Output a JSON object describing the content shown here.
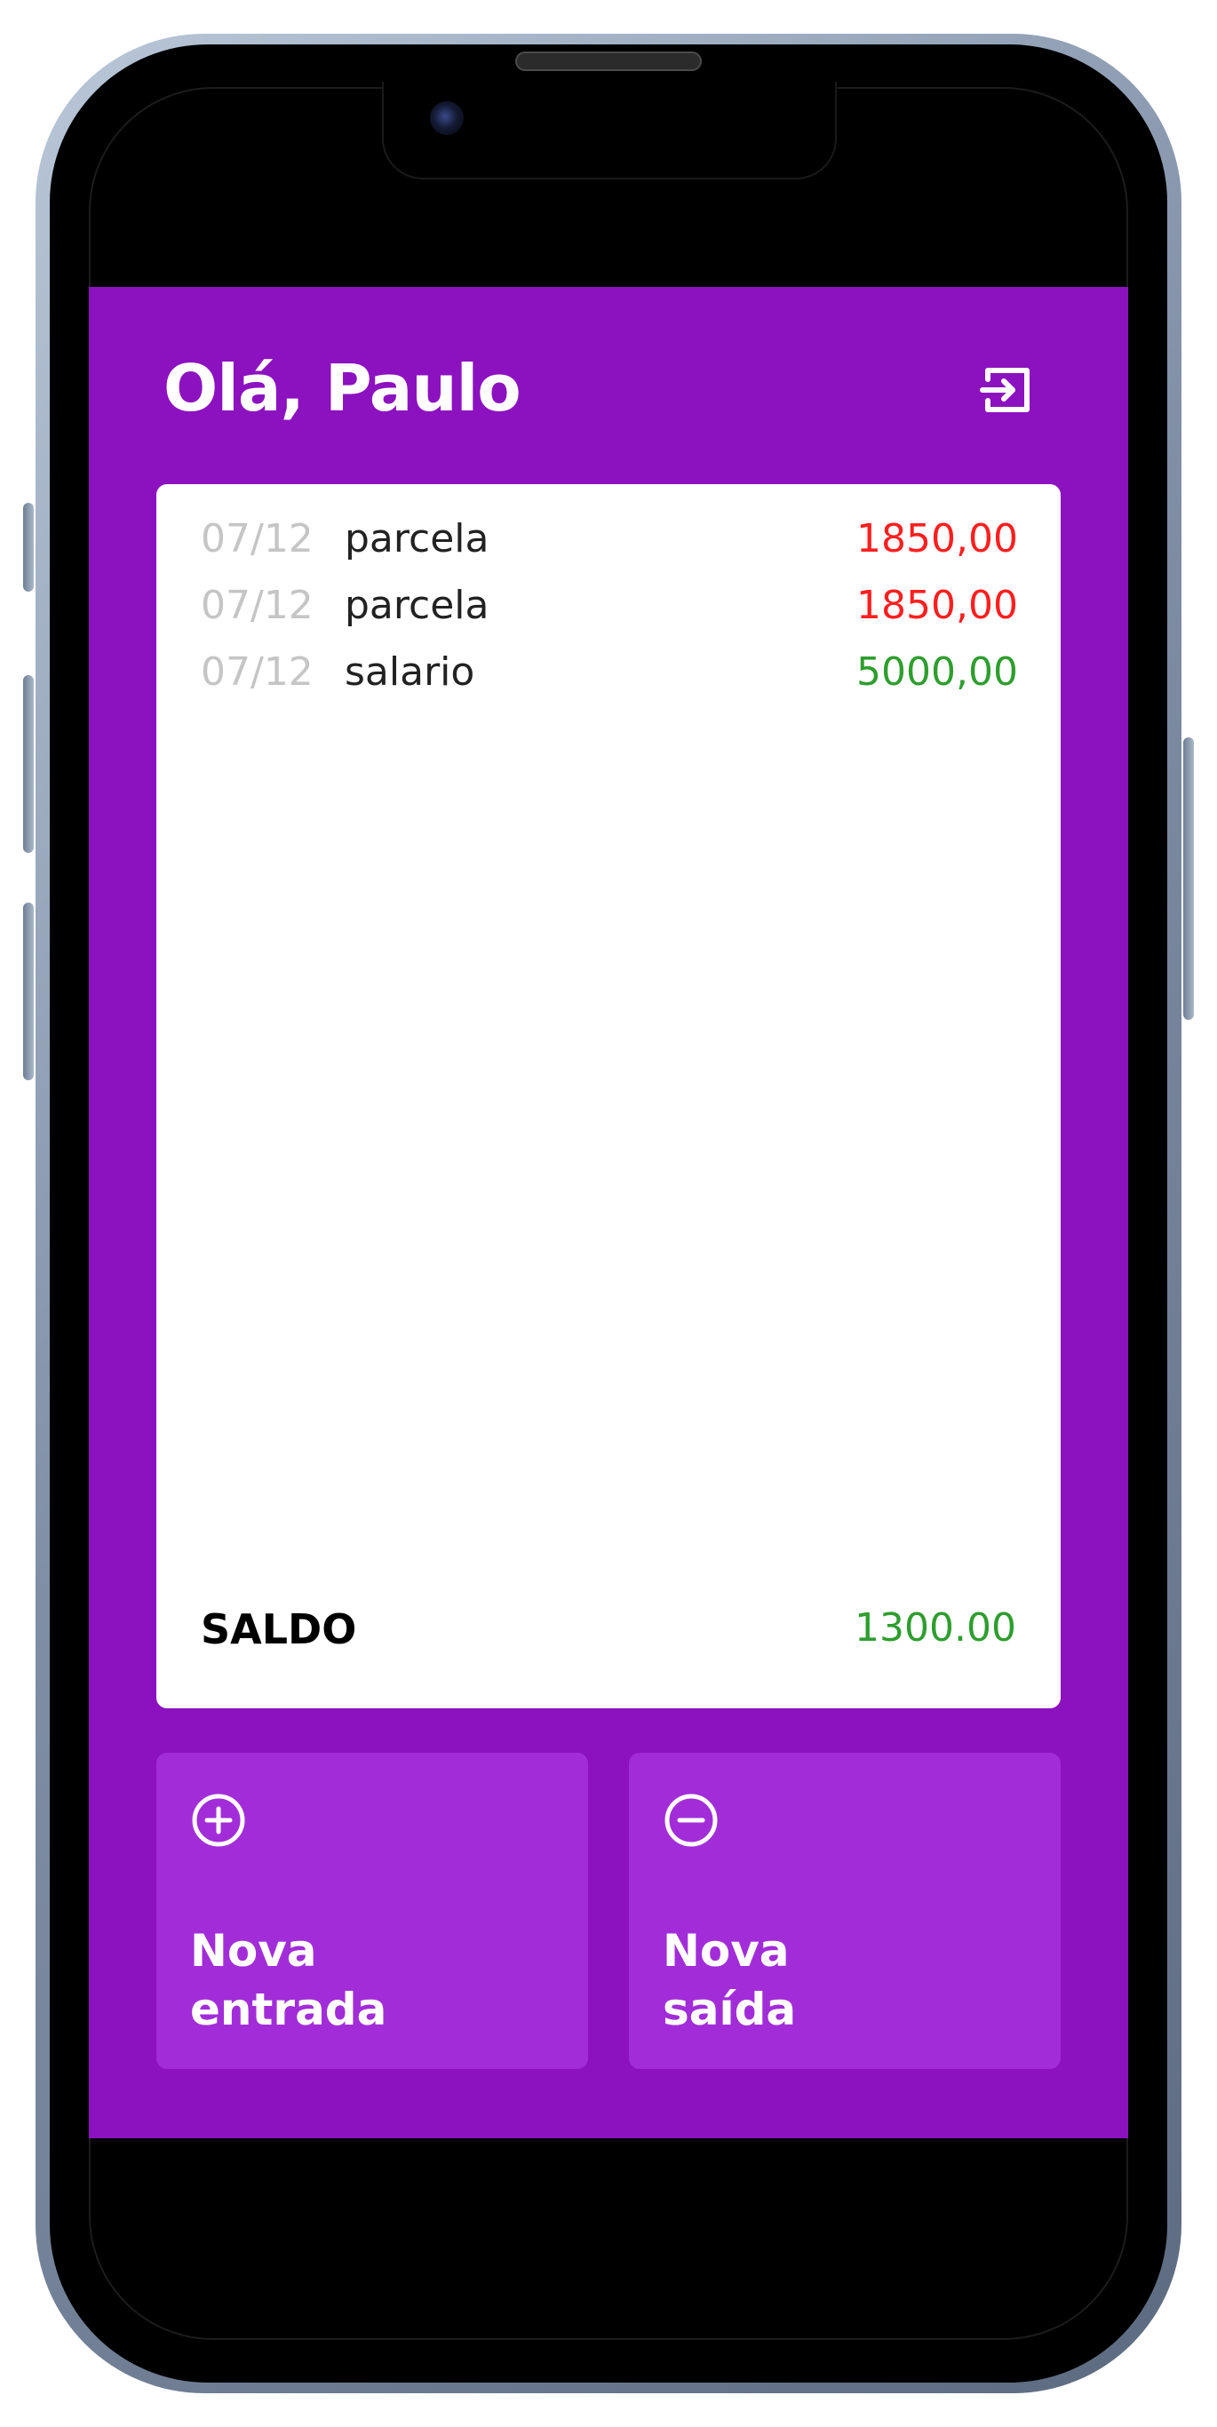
{
  "header": {
    "greeting": "Olá, Paulo",
    "logout_icon": "logout-icon"
  },
  "transactions": [
    {
      "date": "07/12",
      "description": "parcela",
      "amount": "1850,00",
      "type": "expense"
    },
    {
      "date": "07/12",
      "description": "parcela",
      "amount": "1850,00",
      "type": "expense"
    },
    {
      "date": "07/12",
      "description": "salario",
      "amount": "5000,00",
      "type": "income"
    }
  ],
  "balance": {
    "label": "SALDO",
    "value": "1300.00",
    "type": "income"
  },
  "actions": {
    "new_entry": {
      "label": "Nova\nentrada",
      "icon": "plus-circle-icon"
    },
    "new_exit": {
      "label": "Nova\nsaída",
      "icon": "minus-circle-icon"
    }
  },
  "colors": {
    "background": "#8c12bf",
    "button": "#a22dd8",
    "income": "#2e9e2e",
    "expense": "#ff1f1f",
    "date": "#c5c5c5"
  }
}
